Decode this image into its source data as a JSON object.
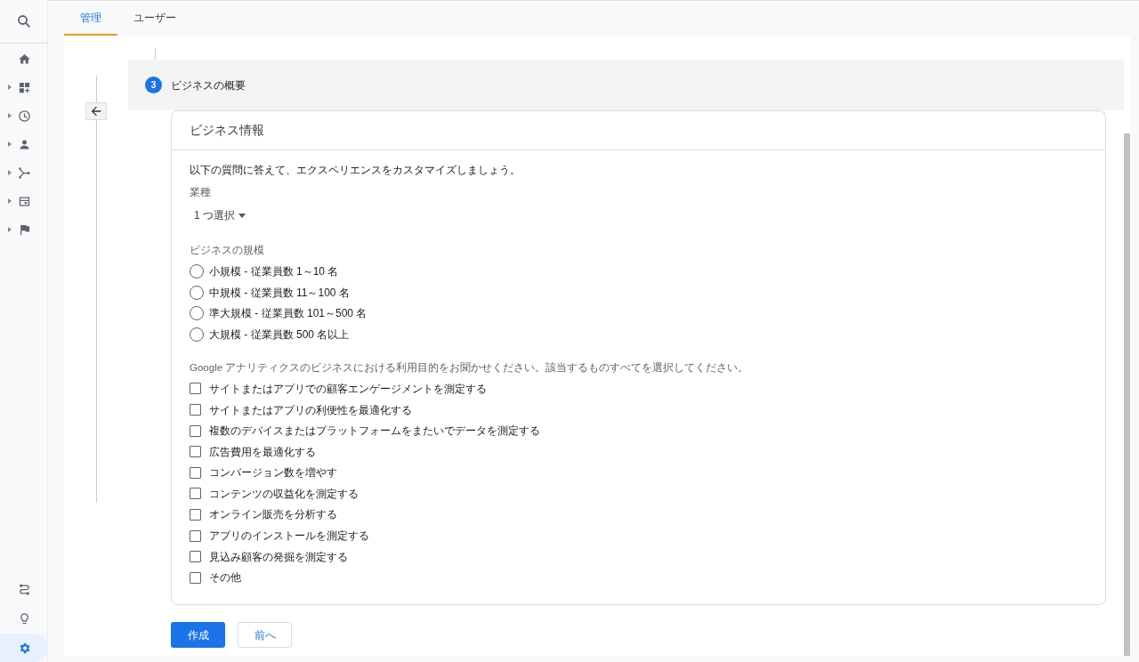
{
  "sidebar": {
    "top_items": [
      {
        "kind": "home",
        "has_caret": false,
        "selected": false
      },
      {
        "kind": "dashboard",
        "has_caret": true,
        "selected": false
      },
      {
        "kind": "clock",
        "has_caret": true,
        "selected": false
      },
      {
        "kind": "person",
        "has_caret": true,
        "selected": false
      },
      {
        "kind": "fork",
        "has_caret": true,
        "selected": false
      },
      {
        "kind": "panel",
        "has_caret": true,
        "selected": false
      },
      {
        "kind": "flag",
        "has_caret": true,
        "selected": false
      }
    ],
    "bottom_items": [
      {
        "kind": "route",
        "has_caret": false,
        "selected": false
      },
      {
        "kind": "bulb",
        "has_caret": false,
        "selected": false
      },
      {
        "kind": "gear",
        "has_caret": false,
        "selected": true
      }
    ]
  },
  "tabs": [
    {
      "label": "管理",
      "selected": true
    },
    {
      "label": "ユーザー",
      "selected": false
    }
  ],
  "step": {
    "number": "3",
    "title": "ビジネスの概要"
  },
  "card": {
    "title": "ビジネス情報",
    "intro": "以下の質問に答えて、エクスペリエンスをカスタマイズしましょう。",
    "industry": {
      "label": "業種",
      "value": "1 つ選択"
    },
    "size": {
      "label": "ビジネスの規模",
      "options": [
        {
          "label": "小規模 - 従業員数 1～10 名",
          "selected": false
        },
        {
          "label": "中規模 - 従業員数 11～100 名",
          "selected": false
        },
        {
          "label": "準大規模 - 従業員数 101～500 名",
          "selected": false
        },
        {
          "label": "大規模 - 従業員数 500 名以上",
          "selected": false
        }
      ]
    },
    "purpose": {
      "label": "Google アナリティクスのビジネスにおける利用目的をお聞かせください。該当するものすべてを選択してください。",
      "options": [
        {
          "label": "サイトまたはアプリでの顧客エンゲージメントを測定する",
          "checked": false
        },
        {
          "label": "サイトまたはアプリの利便性を最適化する",
          "checked": false
        },
        {
          "label": "複数のデバイスまたはプラットフォームをまたいでデータを測定する",
          "checked": false
        },
        {
          "label": "広告費用を最適化する",
          "checked": false
        },
        {
          "label": "コンバージョン数を増やす",
          "checked": false
        },
        {
          "label": "コンテンツの収益化を測定する",
          "checked": false
        },
        {
          "label": "オンライン販売を分析する",
          "checked": false
        },
        {
          "label": "アプリのインストールを測定する",
          "checked": false
        },
        {
          "label": "見込み顧客の発掘を測定する",
          "checked": false
        },
        {
          "label": "その他",
          "checked": false
        }
      ]
    }
  },
  "buttons": {
    "primary": "作成",
    "secondary": "前へ"
  }
}
